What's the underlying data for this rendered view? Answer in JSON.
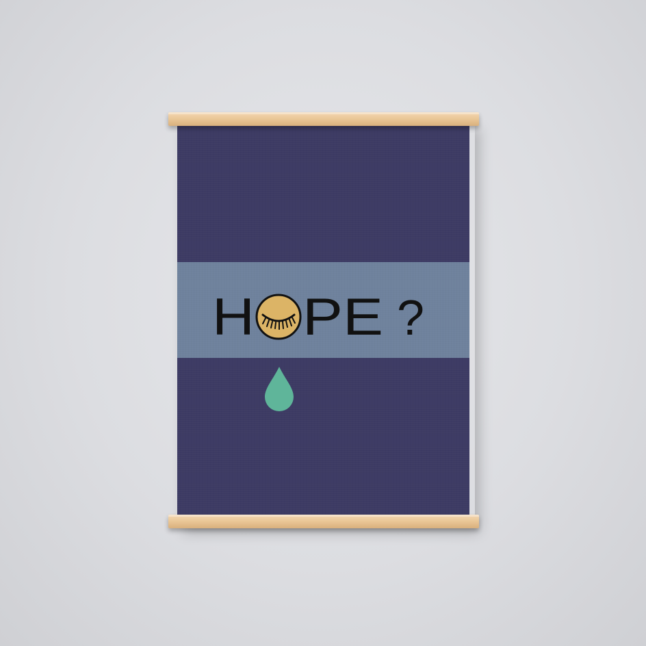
{
  "poster": {
    "word_before_eye": "H",
    "word_after_eye": "PE",
    "punctuation": "?",
    "colors": {
      "wall": "#dcdde1",
      "poster_background": "#3d3b64",
      "band": "#6f829d",
      "eye_circle": "#dcb466",
      "teardrop": "#5fb59a",
      "text": "#111111",
      "wood": "#ebc898"
    },
    "icons": [
      "closed-eye-icon",
      "teardrop-icon"
    ]
  }
}
